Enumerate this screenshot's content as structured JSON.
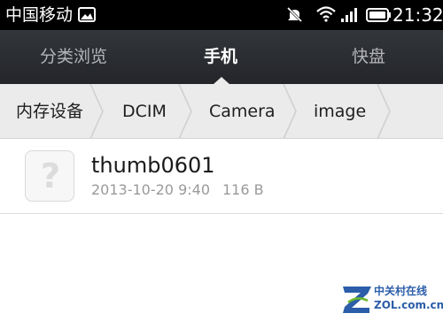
{
  "status_bar": {
    "carrier": "中国移动",
    "time": "21:32",
    "icons": [
      "gallery-icon",
      "mute-icon",
      "wifi-icon",
      "signal-icon",
      "battery-icon"
    ]
  },
  "tabs": [
    {
      "label": "分类浏览",
      "active": false
    },
    {
      "label": "手机",
      "active": true
    },
    {
      "label": "快盘",
      "active": false
    }
  ],
  "breadcrumb": [
    "内存设备",
    "DCIM",
    "Camera",
    "image"
  ],
  "files": [
    {
      "icon": "unknown-file-icon",
      "name": "thumb0601",
      "date": "2013-10-20 9:40",
      "size": "116 B"
    }
  ],
  "watermark": {
    "cn": "中关村在线",
    "en": "ZOL.com.cn"
  },
  "colors": {
    "status_bar": "#000000",
    "tab_bar": "#2b2e33",
    "breadcrumb_bg": "#ebebeb",
    "watermark": "#2b5da8"
  }
}
